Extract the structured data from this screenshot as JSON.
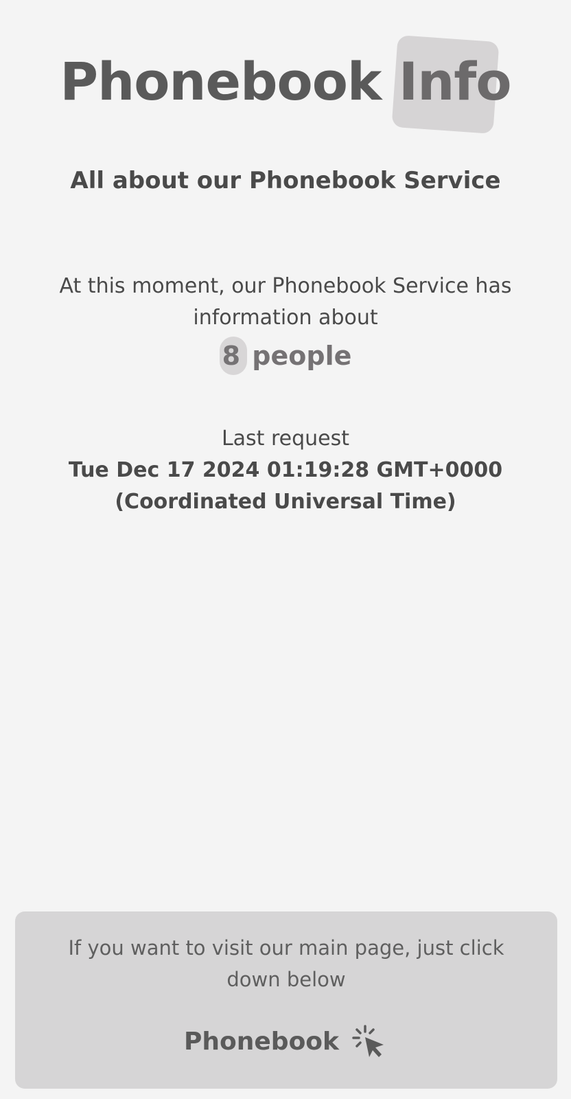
{
  "header": {
    "title_main": "Phonebook",
    "title_highlight": "Info",
    "subtitle": "All about our Phonebook Service"
  },
  "info": {
    "intro": "At this moment, our Phonebook Service has information about",
    "count": "8",
    "count_unit": "people"
  },
  "last_request": {
    "label": "Last request",
    "value": "Tue Dec 17 2024 01:19:28 GMT+0000 (Coordinated Universal Time)"
  },
  "footer": {
    "text": "If you want to visit our main page, just click down below",
    "link_label": "Phonebook",
    "link_icon": "click-icon"
  },
  "colors": {
    "background": "#f4f4f4",
    "footer_background": "#d6d5d6",
    "highlight": "#d6d4d5",
    "text": "#4a4a4a"
  }
}
